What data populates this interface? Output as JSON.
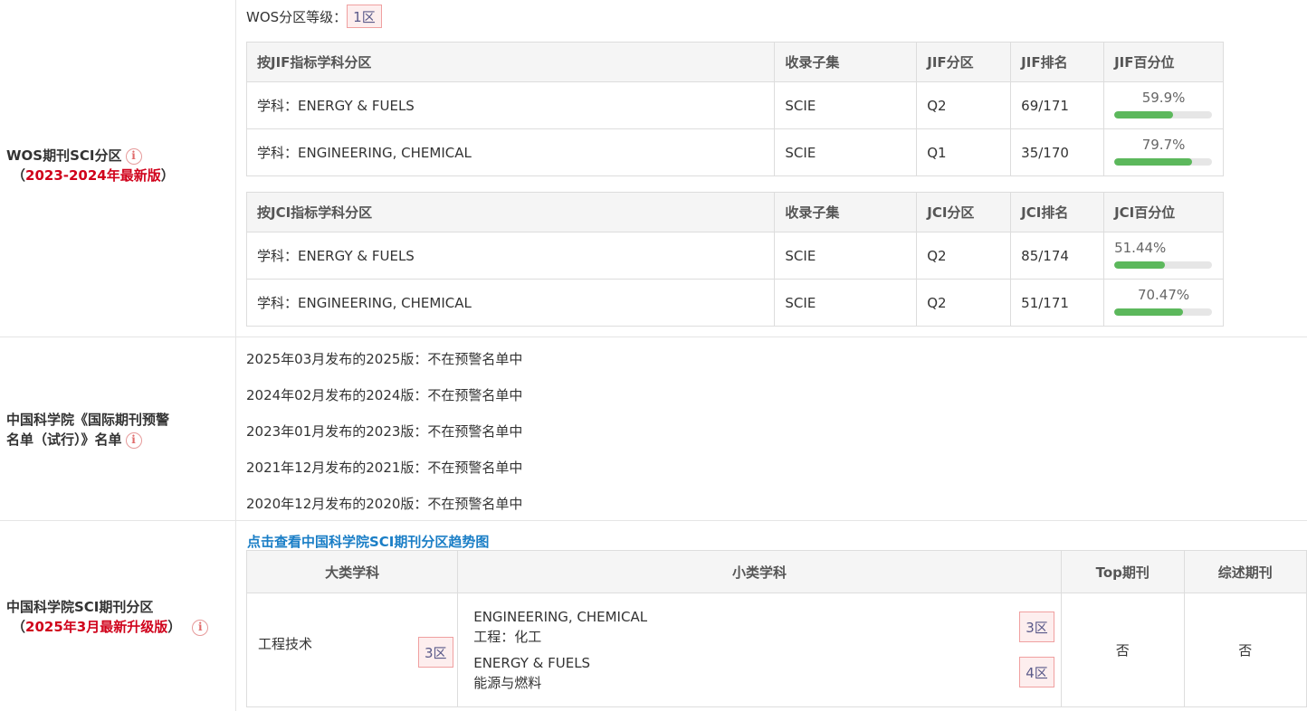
{
  "wos": {
    "label_title": "WOS期刊SCI分区",
    "label_edition": "2023-2024年最新版",
    "label_open": "（",
    "label_close": "）",
    "grade_label": "WOS分区等级：",
    "grade_value": "1区",
    "jif_headers": [
      "按JIF指标学科分区",
      "收录子集",
      "JIF分区",
      "JIF排名",
      "JIF百分位"
    ],
    "jif_rows": [
      {
        "subject": "学科：ENERGY & FUELS",
        "collection": "SCIE",
        "quartile": "Q2",
        "rank": "69/171",
        "percentile": "59.9%",
        "percentile_value": 59.9
      },
      {
        "subject": "学科：ENGINEERING, CHEMICAL",
        "collection": "SCIE",
        "quartile": "Q1",
        "rank": "35/170",
        "percentile": "79.7%",
        "percentile_value": 79.7
      }
    ],
    "jci_headers": [
      "按JCI指标学科分区",
      "收录子集",
      "JCI分区",
      "JCI排名",
      "JCI百分位"
    ],
    "jci_rows": [
      {
        "subject": "学科：ENERGY & FUELS",
        "collection": "SCIE",
        "quartile": "Q2",
        "rank": "85/174",
        "percentile": "51.44%",
        "percentile_value": 51.44
      },
      {
        "subject": "学科：ENGINEERING, CHEMICAL",
        "collection": "SCIE",
        "quartile": "Q2",
        "rank": "51/171",
        "percentile": "70.47%",
        "percentile_value": 70.47
      }
    ]
  },
  "warning": {
    "label_line1": "中国科学院《国际期刊预警",
    "label_line2": "名单（试行）》名单",
    "lines": [
      "2025年03月发布的2025版：不在预警名单中",
      "2024年02月发布的2024版：不在预警名单中",
      "2023年01月发布的2023版：不在预警名单中",
      "2021年12月发布的2021版：不在预警名单中",
      "2020年12月发布的2020版：不在预警名单中"
    ]
  },
  "cas": {
    "label_title": "中国科学院SCI期刊分区",
    "label_edition": "2025年3月最新升级版",
    "label_open": "（",
    "label_close": "）",
    "trend_link": "点击查看中国科学院SCI期刊分区趋势图",
    "headers": [
      "大类学科",
      "小类学科",
      "Top期刊",
      "综述期刊"
    ],
    "major": {
      "name": "工程技术",
      "zone": "3区"
    },
    "minors": [
      {
        "en": "ENGINEERING, CHEMICAL",
        "cn": "工程：化工",
        "zone": "3区"
      },
      {
        "en": "ENERGY & FUELS",
        "cn": "能源与燃料",
        "zone": "4区"
      }
    ],
    "top": "否",
    "review": "否"
  },
  "icons": {
    "info": "info-icon"
  },
  "colors": {
    "accent_red": "#d0021b",
    "link_blue": "#1a7ec6",
    "bar_green": "#5cb85c"
  }
}
